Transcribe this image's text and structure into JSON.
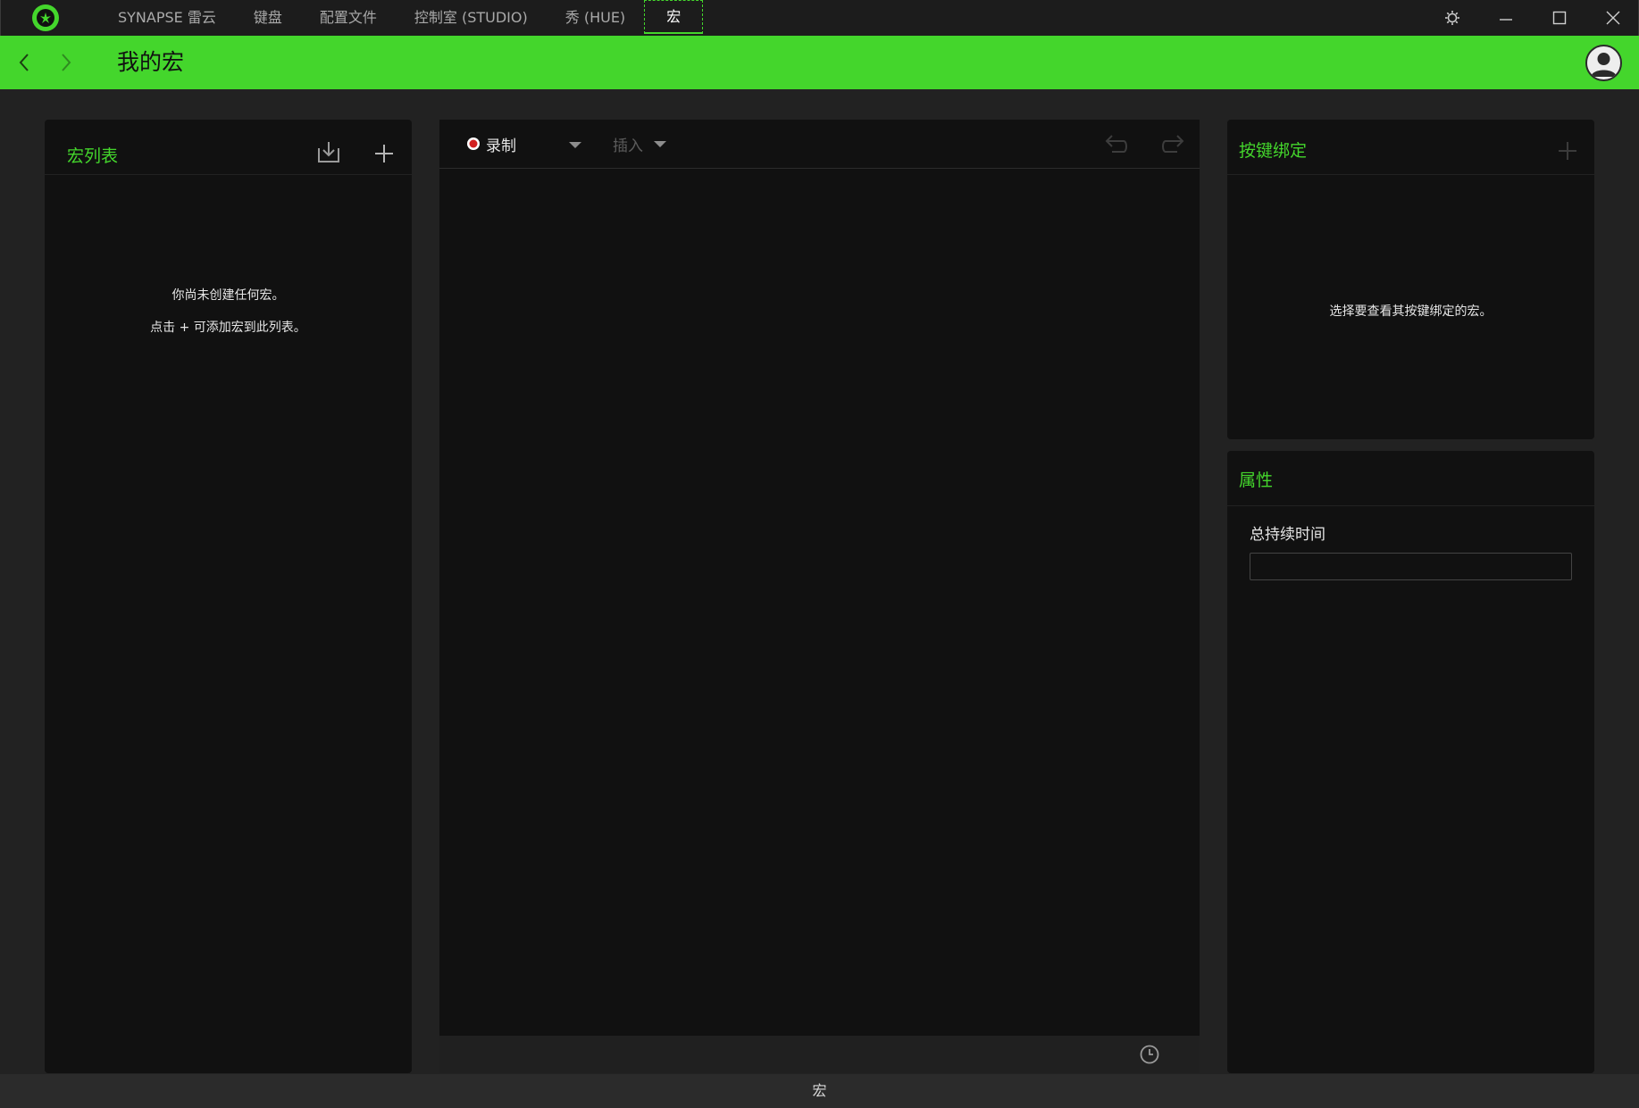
{
  "titlebar": {
    "tabs": [
      {
        "label": "SYNAPSE 雷云",
        "active": false
      },
      {
        "label": "键盘",
        "active": false
      },
      {
        "label": "配置文件",
        "active": false
      },
      {
        "label": "控制室 (STUDIO)",
        "active": false
      },
      {
        "label": "秀 (HUE)",
        "active": false
      },
      {
        "label": "宏",
        "active": true
      }
    ],
    "icons": [
      "razer-logo-icon",
      "settings-icon",
      "minimize-icon",
      "maximize-icon",
      "close-icon"
    ]
  },
  "header": {
    "title": "我的宏",
    "accent_color": "#44d62c"
  },
  "macro_list": {
    "title": "宏列表",
    "empty_line1": "你尚未创建任何宏。",
    "empty_line2": "点击 + 可添加宏到此列表。"
  },
  "editor": {
    "record_label": "录制",
    "insert_label": "插入"
  },
  "key_binding": {
    "title": "按键绑定",
    "empty_text": "选择要查看其按键绑定的宏。"
  },
  "properties": {
    "title": "属性",
    "total_duration_label": "总持续时间",
    "total_duration_value": ""
  },
  "status_bar": {
    "text": "宏"
  }
}
